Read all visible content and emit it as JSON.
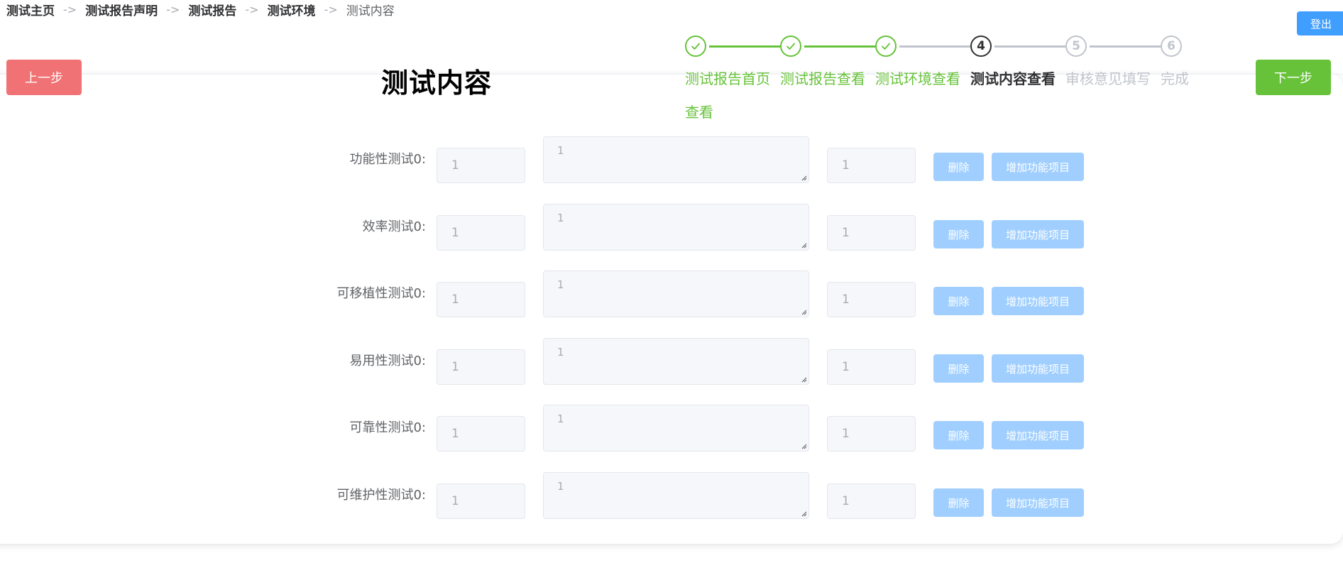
{
  "breadcrumb": [
    {
      "label": "测试主页"
    },
    {
      "label": "测试报告声明"
    },
    {
      "label": "测试报告"
    },
    {
      "label": "测试环境"
    },
    {
      "label": "测试内容"
    }
  ],
  "breadcrumb_separator": "->",
  "logout_label": "登出",
  "prev_label": "上一步",
  "next_label": "下一步",
  "page_title": "测试内容",
  "steps": [
    {
      "number": "1",
      "title": "测试报告首页查看",
      "status": "done",
      "icon": "check-icon"
    },
    {
      "number": "2",
      "title": "测试报告查看",
      "status": "done",
      "icon": "check-icon"
    },
    {
      "number": "3",
      "title": "测试环境查看",
      "status": "done",
      "icon": "check-icon"
    },
    {
      "number": "4",
      "title": "测试内容查看",
      "status": "process"
    },
    {
      "number": "5",
      "title": "审核意见填写",
      "status": "wait"
    },
    {
      "number": "6",
      "title": "完成",
      "status": "wait"
    }
  ],
  "rows": [
    {
      "label": "功能性测试0:",
      "input1": "1",
      "textarea": "1",
      "input3": "1",
      "delete_label": "删除",
      "add_label": "增加功能项目"
    },
    {
      "label": "效率测试0:",
      "input1": "1",
      "textarea": "1",
      "input3": "1",
      "delete_label": "删除",
      "add_label": "增加功能项目"
    },
    {
      "label": "可移植性测试0:",
      "input1": "1",
      "textarea": "1",
      "input3": "1",
      "delete_label": "删除",
      "add_label": "增加功能项目"
    },
    {
      "label": "易用性测试0:",
      "input1": "1",
      "textarea": "1",
      "input3": "1",
      "delete_label": "删除",
      "add_label": "增加功能项目"
    },
    {
      "label": "可靠性测试0:",
      "input1": "1",
      "textarea": "1",
      "input3": "1",
      "delete_label": "删除",
      "add_label": "增加功能项目"
    },
    {
      "label": "可维护性测试0:",
      "input1": "1",
      "textarea": "1",
      "input3": "1",
      "delete_label": "删除",
      "add_label": "增加功能项目"
    }
  ],
  "colors": {
    "primary": "#409eff",
    "success": "#67c23a",
    "danger_light": "#f07274",
    "primary_disabled": "#a0cfff",
    "wait": "#c0c4cc"
  }
}
